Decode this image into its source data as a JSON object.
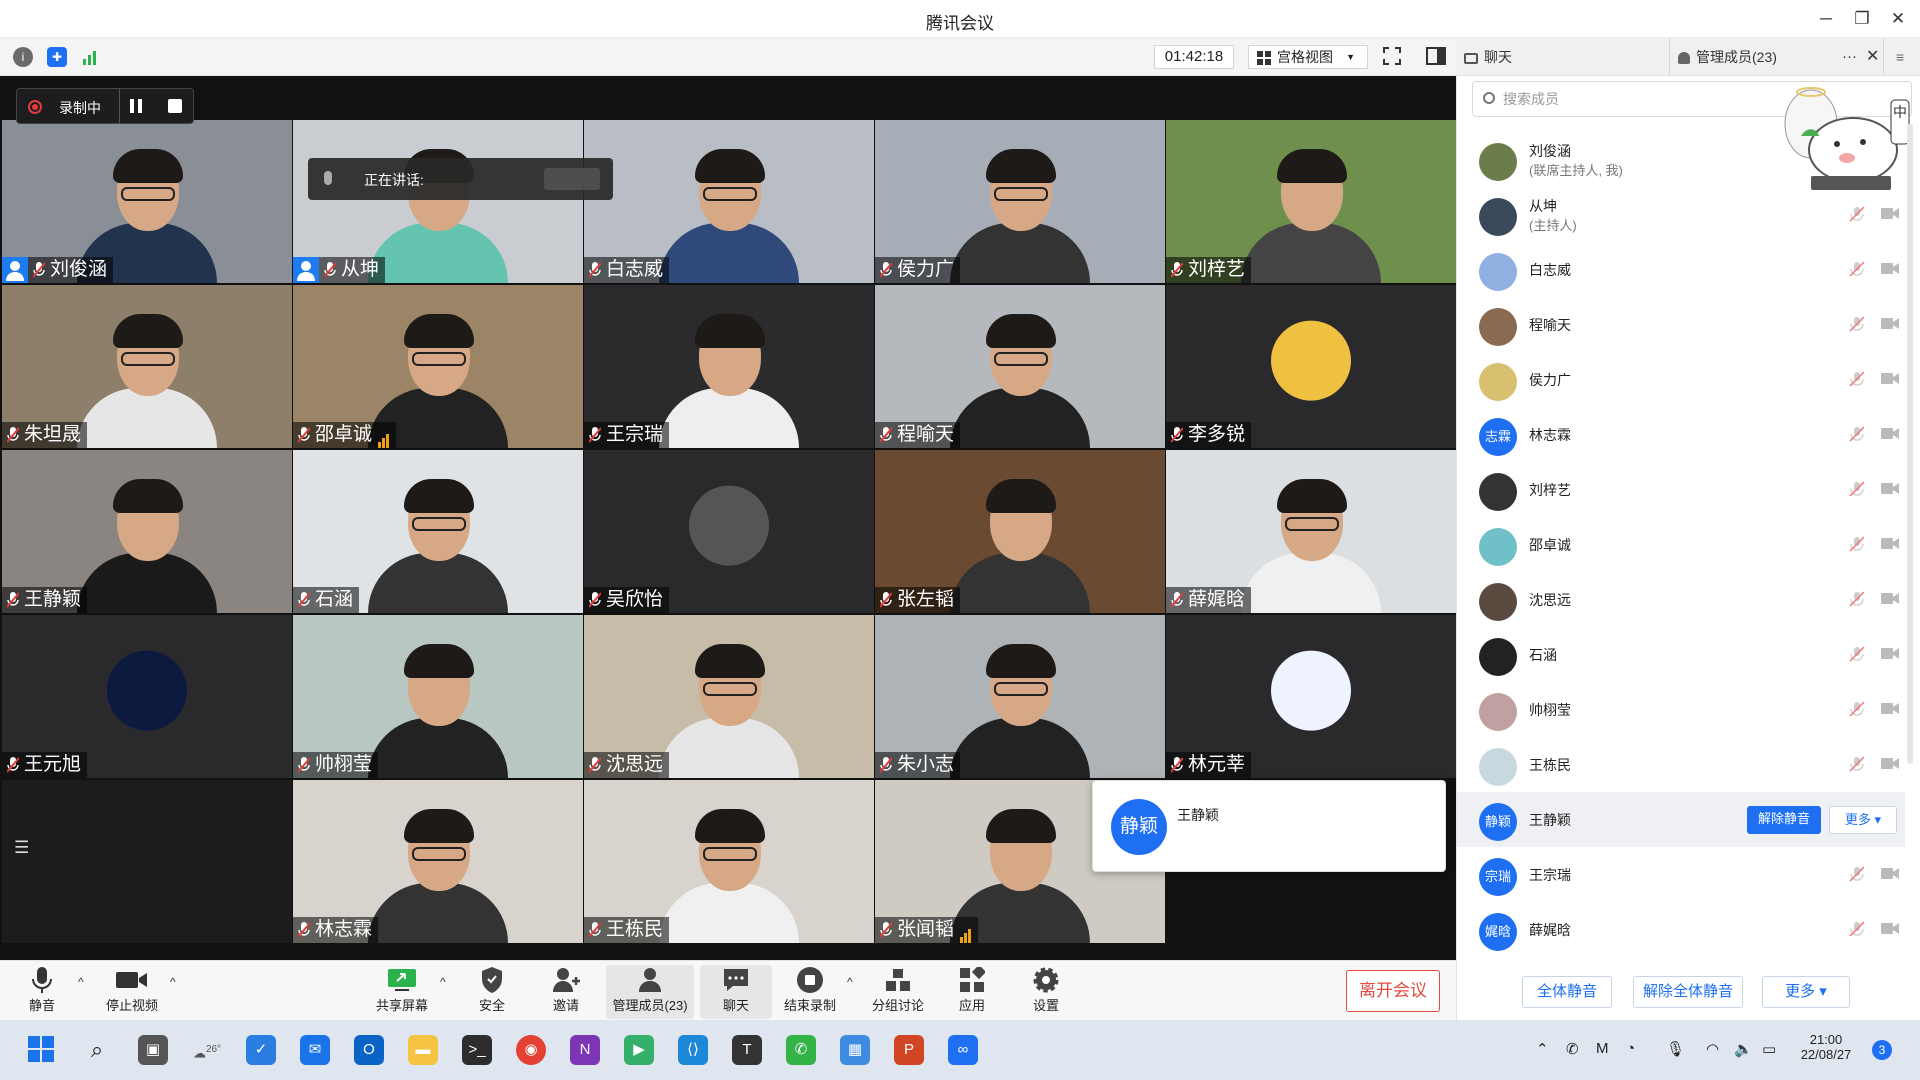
{
  "window": {
    "title": "腾讯会议",
    "minimize": "─",
    "restore": "❐",
    "close": "✕"
  },
  "toolbar": {
    "timer": "01:42:18",
    "view_label": "宫格视图",
    "view_caret": "▼"
  },
  "right_tabs": {
    "chat": "聊天",
    "members": "管理成员(23)",
    "more": "···",
    "close": "✕"
  },
  "recording": {
    "label": "录制中"
  },
  "speaking": {
    "label": "正在讲话:"
  },
  "tiles": [
    {
      "name": "刘俊涵",
      "host": true
    },
    {
      "name": "从坤",
      "host": true
    },
    {
      "name": "白志威"
    },
    {
      "name": "侯力广"
    },
    {
      "name": "刘梓艺"
    },
    {
      "name": "朱坦晟"
    },
    {
      "name": "邵卓诚",
      "signal": true
    },
    {
      "name": "王宗瑞"
    },
    {
      "name": "程喻天"
    },
    {
      "name": "李多锐"
    },
    {
      "name": "王静颖"
    },
    {
      "name": "石涵"
    },
    {
      "name": "吴欣怡"
    },
    {
      "name": "张左韬"
    },
    {
      "name": "薛娓晗"
    },
    {
      "name": "王元旭"
    },
    {
      "name": "帅栩莹"
    },
    {
      "name": "沈思远"
    },
    {
      "name": "朱小志"
    },
    {
      "name": "林元莘"
    },
    {
      "name": "林志霖"
    },
    {
      "name": "王栋民"
    },
    {
      "name": "张闻韬",
      "signal": true
    }
  ],
  "popup": {
    "avatar_text": "静颖",
    "name": "王静颖"
  },
  "bottom": {
    "mute": "静音",
    "video": "停止视频",
    "share": "共享屏幕",
    "security": "安全",
    "invite": "邀请",
    "members": "管理成员(23)",
    "chat": "聊天",
    "end_record": "结束录制",
    "breakout": "分组讨论",
    "apps": "应用",
    "settings": "设置",
    "leave": "离开会议",
    "caret": "^"
  },
  "panel": {
    "search_placeholder": "搜索成员",
    "members": [
      {
        "name": "刘俊涵",
        "sub": "(联席主持人, 我)"
      },
      {
        "name": "从坤",
        "sub": "(主持人)"
      },
      {
        "name": "白志威"
      },
      {
        "name": "程喻天"
      },
      {
        "name": "侯力广"
      },
      {
        "name": "林志霖",
        "avatar_text": "志霖"
      },
      {
        "name": "刘梓艺"
      },
      {
        "name": "邵卓诚"
      },
      {
        "name": "沈思远"
      },
      {
        "name": "石涵"
      },
      {
        "name": "帅栩莹"
      },
      {
        "name": "王栋民"
      },
      {
        "name": "王静颖",
        "avatar_text": "静颖"
      },
      {
        "name": "王宗瑞",
        "avatar_text": "宗瑞"
      },
      {
        "name": "薛娓晗",
        "avatar_text": "娓晗"
      }
    ],
    "unmute_btn": "解除静音",
    "more_btn": "更多 ▾",
    "mute_all": "全体静音",
    "unmute_all": "解除全体静音",
    "more_bottom": "更多 ▾"
  },
  "taskbar": {
    "weather": "26°",
    "time": "21:00",
    "date": "22/08/27",
    "notif": "3",
    "ime": "中"
  },
  "colors": {
    "accent": "#1e6ff2",
    "record": "#e23b3b",
    "leave": "#e04b3f"
  }
}
